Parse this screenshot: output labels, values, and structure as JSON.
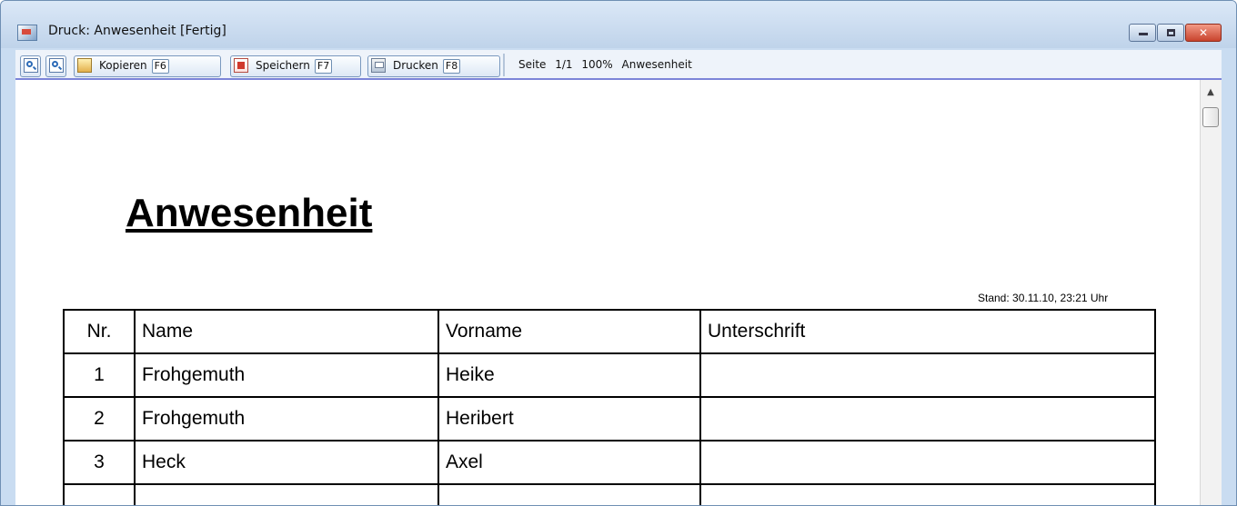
{
  "window": {
    "title": "Druck: Anwesenheit [Fertig]",
    "controls": {
      "minimize": "minimize-icon",
      "maximize": "maximize-icon",
      "close": "close-icon"
    }
  },
  "toolbar": {
    "zoom_in_icon": "zoom-in-icon",
    "zoom_out_icon": "zoom-out-icon",
    "copy_label": "Kopieren",
    "copy_key": "F6",
    "save_label": "Speichern",
    "save_key": "F7",
    "print_label": "Drucken",
    "print_key": "F8",
    "page_info": "Seite 1/1",
    "zoom_level": "100%",
    "document_name": "Anwesenheit"
  },
  "document": {
    "title": "Anwesenheit",
    "stamp": "Stand: 30.11.10, 23:21 Uhr",
    "table": {
      "headers": [
        "Nr.",
        "Name",
        "Vorname",
        "Unterschrift"
      ],
      "rows": [
        {
          "nr": "1",
          "name": "Frohgemuth",
          "vorname": "Heike",
          "unterschrift": ""
        },
        {
          "nr": "2",
          "name": "Frohgemuth",
          "vorname": "Heribert",
          "unterschrift": ""
        },
        {
          "nr": "3",
          "name": "Heck",
          "vorname": "Axel",
          "unterschrift": ""
        }
      ]
    }
  },
  "colors": {
    "titlebar": "#c9dcf1",
    "toolbar_rule": "#7c84d8",
    "close_button": "#c8432d"
  }
}
